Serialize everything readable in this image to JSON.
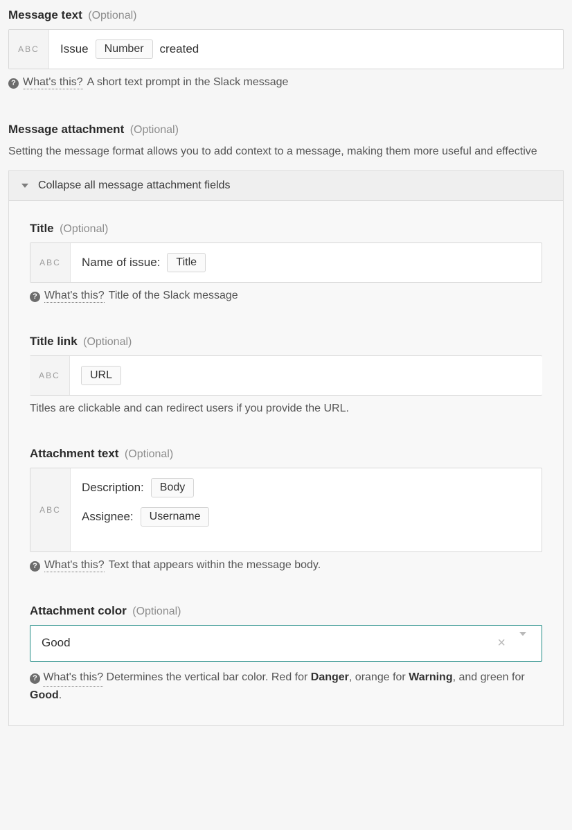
{
  "common": {
    "optional": "(Optional)",
    "whats_this": "What's this?",
    "abc": "ABC"
  },
  "message_text": {
    "label": "Message text",
    "value_pre": "Issue",
    "chip": "Number",
    "value_post": "created",
    "help_desc": "A short text prompt in the Slack message"
  },
  "message_attachment": {
    "label": "Message attachment",
    "description": "Setting the message format allows you to add context to a message, making them more useful and effective",
    "collapse_label": "Collapse all message attachment fields"
  },
  "title": {
    "label": "Title",
    "value_pre": "Name of issue:",
    "chip": "Title",
    "help_desc": "Title of the Slack message"
  },
  "title_link": {
    "label": "Title link",
    "chip": "URL",
    "help_desc": "Titles are clickable and can redirect users if you provide the URL."
  },
  "attachment_text": {
    "label": "Attachment text",
    "line1_pre": "Description:",
    "line1_chip": "Body",
    "line2_pre": "Assignee:",
    "line2_chip": "Username",
    "help_desc": "Text that appears within the message body."
  },
  "attachment_color": {
    "label": "Attachment color",
    "value": "Good",
    "help_pre": "Determines the vertical bar color. Red for ",
    "danger": "Danger",
    "mid1": ", orange for ",
    "warning": "Warning",
    "mid2": ", and green for ",
    "good": "Good",
    "tail": "."
  }
}
